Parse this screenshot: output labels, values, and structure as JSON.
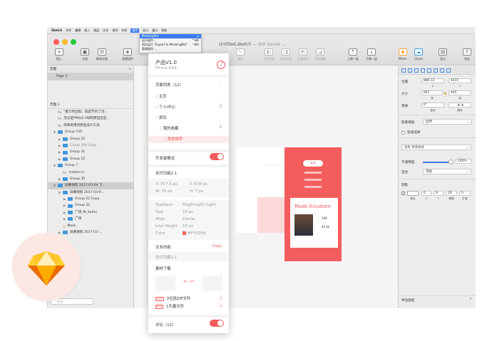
{
  "menubar": {
    "app": "Sketch",
    "items": [
      "文件",
      "编辑",
      "插入",
      "图层",
      "文本",
      "排列",
      "共享",
      "插件",
      "显示",
      "窗口",
      "帮助"
    ],
    "active_index": 7
  },
  "dropdown": {
    "items": [
      {
        "label": "MockingBot",
        "shortcut": "▸",
        "highlighted": true
      },
      {
        "label": "运行插件...",
        "shortcut": "^⌘K",
        "highlighted": false
      },
      {
        "label": "再次运行 \"Export to MockingBot\"",
        "shortcut": "^⌘R",
        "highlighted": false
      },
      {
        "label": "管理插件...",
        "shortcut": "",
        "highlighted": false
      }
    ]
  },
  "window": {
    "title": "Untitled.sketch",
    "title_suffix": " — Not Saved",
    "title_caret": "⌄"
  },
  "toolbar": {
    "left": [
      {
        "label": "插入",
        "icon": "+"
      },
      {
        "label": "分组",
        "icon": "▣"
      },
      {
        "label": "取消分组",
        "icon": "⊟"
      },
      {
        "label": "创建组件",
        "icon": "◈"
      }
    ],
    "middle": [
      {
        "label": "路径",
        "icon": "✎"
      },
      {
        "label": "合并形状",
        "icon": "◧"
      },
      {
        "label": "减去顶层",
        "icon": "◨"
      },
      {
        "label": "区域相交",
        "icon": "◩"
      },
      {
        "label": "排除重叠",
        "icon": "◪"
      },
      {
        "label": "上移一层",
        "icon": "⇡"
      },
      {
        "label": "下移一层",
        "icon": "⇣"
      }
    ],
    "right": [
      {
        "label": "Mirror",
        "icon": "◆"
      },
      {
        "label": "Cloud",
        "icon": "☁"
      },
      {
        "label": "显示",
        "icon": "▤"
      },
      {
        "label": "导出",
        "icon": "⇪"
      }
    ]
  },
  "leftpanel": {
    "pages_header": "页面",
    "add_icon": "+",
    "pages": [
      "Page 1"
    ],
    "page_header": "页面 1",
    "layers": [
      {
        "kind": "text",
        "label": "\"墨刀的出现，就是节约了沟...",
        "indent": 0
      },
      {
        "kind": "text",
        "label": "无论是PM从0-1绘制原型还是...",
        "indent": 0
      },
      {
        "kind": "text",
        "label": "简单易用的原型设计工具",
        "indent": 0
      },
      {
        "kind": "group",
        "label": "Group 110",
        "indent": 0,
        "open": true
      },
      {
        "kind": "group",
        "label": "Group 32",
        "indent": 1
      },
      {
        "kind": "group",
        "label": "Group 106 Copy",
        "indent": 1,
        "dim": true
      },
      {
        "kind": "group",
        "label": "Group 31",
        "indent": 1
      },
      {
        "kind": "group",
        "label": "Group 22",
        "indent": 1
      },
      {
        "kind": "group",
        "label": "Group 7",
        "indent": 0,
        "open": true
      },
      {
        "kind": "text",
        "label": "modao.cc",
        "indent": 1
      },
      {
        "kind": "group",
        "label": "Group 35",
        "indent": 1
      },
      {
        "kind": "group",
        "label": "屏幕快照 2017-03-04 下...",
        "indent": 0,
        "open": true,
        "selected": true
      },
      {
        "kind": "group",
        "label": "屏幕快照 2017-03-0...",
        "indent": 1,
        "open": true
      },
      {
        "kind": "group",
        "label": "Group 22 Copy",
        "indent": 2
      },
      {
        "kind": "group",
        "label": "Group 22",
        "indent": 2
      },
      {
        "kind": "group",
        "label": "广场_M_Safari",
        "indent": 2
      },
      {
        "kind": "group",
        "label": "广场",
        "indent": 2
      },
      {
        "kind": "shape",
        "label": "Mask",
        "indent": 1
      },
      {
        "kind": "group",
        "label": "屏幕快照 2017-03-...",
        "indent": 1
      }
    ],
    "footer_label": "过滤"
  },
  "plugin": {
    "project_name": "产品V1.0",
    "device": "iPhone 6/6S",
    "pages_label": "页面列表（12）",
    "tree": [
      {
        "label": "主页",
        "indent": 0,
        "count": ""
      },
      {
        "label": "个人/中心",
        "indent": 0,
        "count": "2"
      },
      {
        "label": "资讯",
        "indent": 0,
        "count": ""
      },
      {
        "label": "我的收藏",
        "indent": 1,
        "count": "2"
      },
      {
        "label": "美食推荐",
        "indent": 2,
        "count": "",
        "active": true
      }
    ],
    "dev_mode_label": "开发者模式",
    "artboard_label": "支付功能2.1",
    "x_label": "X",
    "x_value": "477.5 px",
    "y_label": "Y",
    "y_value": "678 px",
    "w_label": "W",
    "w_value": "35 px",
    "h_label": "H",
    "h_value": "7 px",
    "typo": [
      {
        "k": "Typeface",
        "v": "PingFangSC-Light"
      },
      {
        "k": "Size",
        "v": "10 px"
      },
      {
        "k": "Align",
        "v": "Center"
      },
      {
        "k": "Line Height",
        "v": "10 px"
      },
      {
        "k": "Color",
        "v": "#F55D54"
      }
    ],
    "text_content_label": "文本内容",
    "copy_label": "Copy",
    "text_content_value": "支付功能2.1",
    "assets_label": "素材下载",
    "downloads": [
      {
        "badge": "PNG",
        "label": "3位倍ZIP文件"
      },
      {
        "badge": "PDF",
        "label": "1矢量文件"
      }
    ],
    "comments_label": "评论（12）",
    "accent": "#f45d5d"
  },
  "inspector": {
    "position_label": "位置",
    "x_value": "889.12",
    "y_value": "4437",
    "x_sub": "X",
    "y_sub": "Y",
    "size_label": "大小",
    "w_value": "661",
    "h_value": "405",
    "w_sub": "宽",
    "h_sub": "高",
    "transform_label": "变换",
    "rotate_value": "0°",
    "rotate_sub": "旋转",
    "flip_sub": "翻转",
    "resize_label": "智能缩放",
    "resize_value": "拉伸",
    "clickthrough_label": "穿透选择",
    "no_style_label": "没有 共享样式",
    "opacity_label": "不透明度",
    "opacity_value": "100%",
    "blend_label": "混合",
    "blend_value": "常规",
    "shadow_label": "阴影",
    "shadow_values": {
      "x": "0",
      "y": "6",
      "blur": "20",
      "spread": "0"
    },
    "shadow_subs": {
      "color": "颜色",
      "x": "X",
      "y": "Y",
      "blur": "模糊",
      "spread": "扩展"
    },
    "export_label": "导出图层"
  },
  "canvas": {
    "phone2_button": "登录",
    "card_name": "Mads Knudsen",
    "card_stats": [
      "346",
      "45.4k"
    ]
  }
}
